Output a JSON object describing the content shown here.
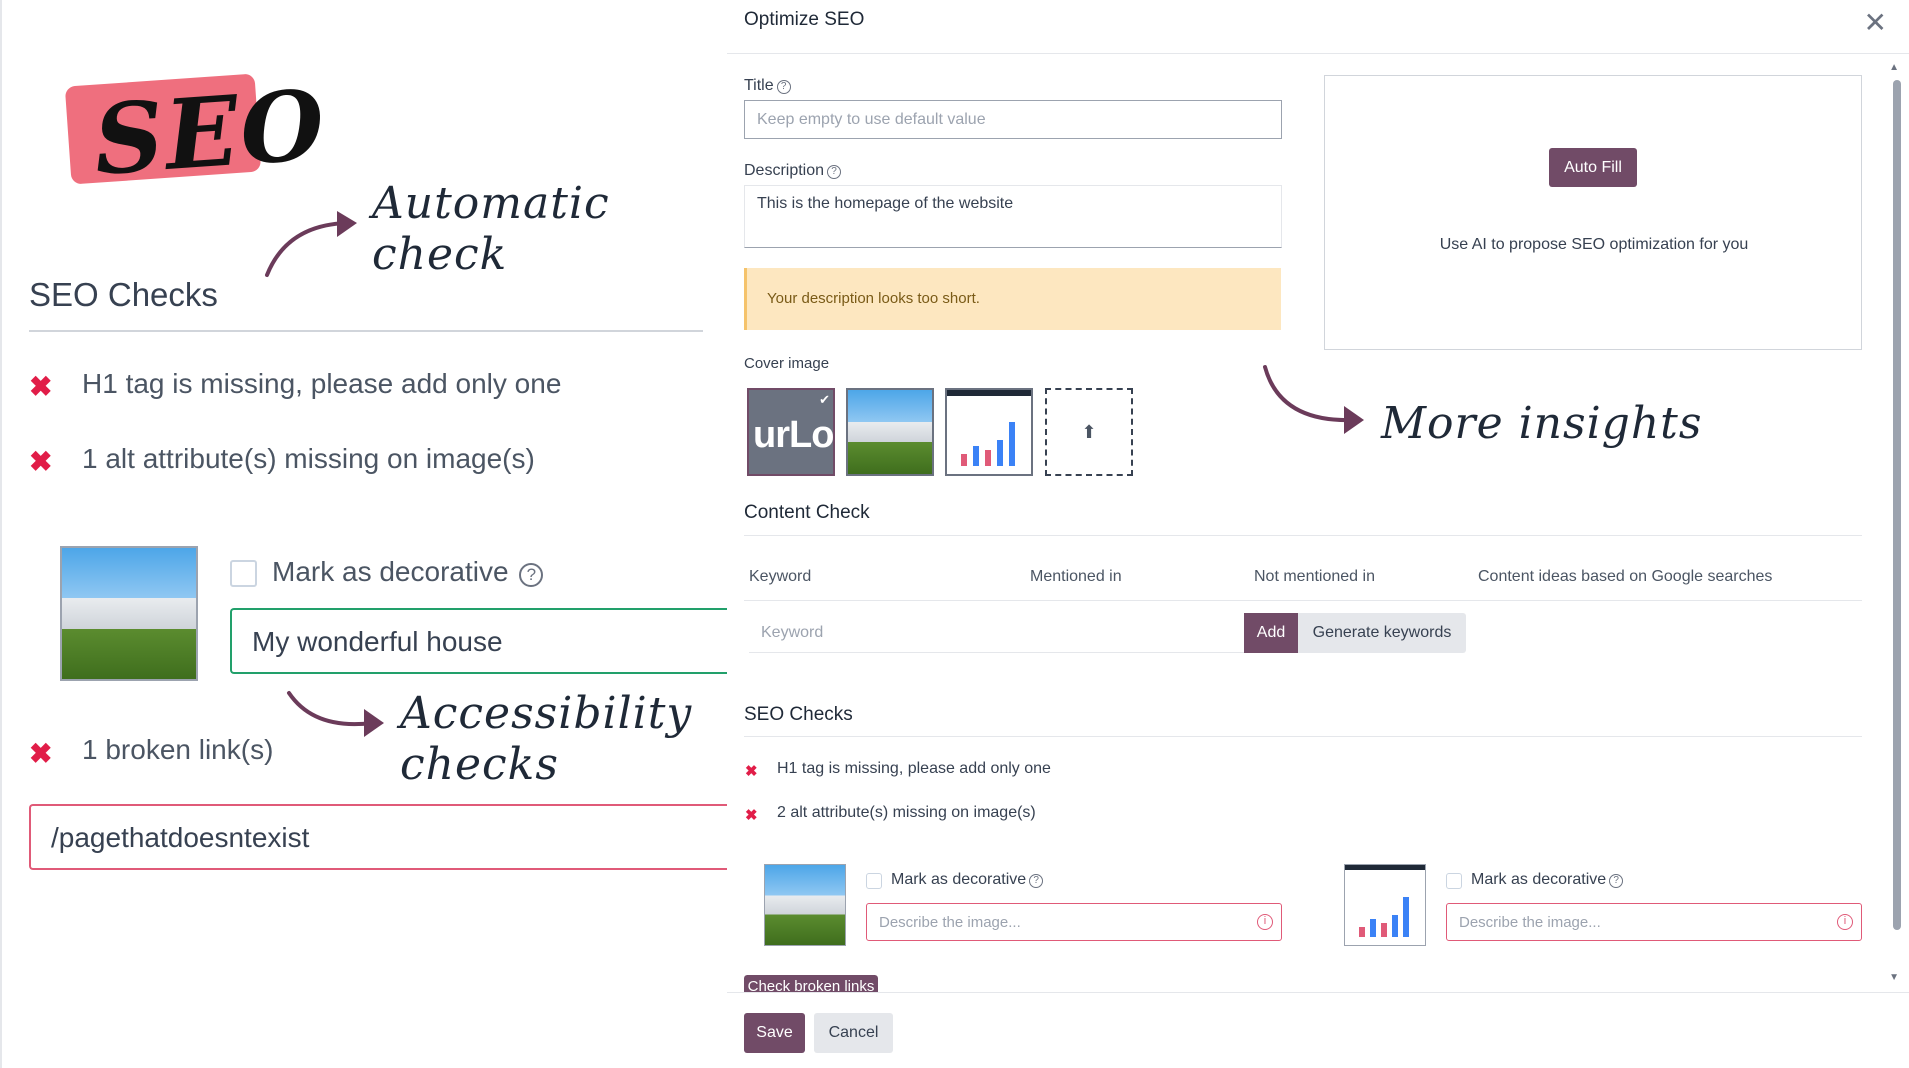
{
  "left_panel": {
    "logo_text": "SEO",
    "callout_automatic": "Automatic check",
    "callout_more": "More insights",
    "callout_accessibility": "Accessibility checks",
    "title": "SEO Checks",
    "checks": [
      "H1 tag is missing, please add only one",
      "1 alt attribute(s) missing on image(s)"
    ],
    "mark_decorative_label": "Mark as decorative",
    "alt_value": "My wonderful house",
    "broken_links_label": "1 broken link(s)",
    "broken_link_value": "/pagethatdoesntexist"
  },
  "modal": {
    "title": "Optimize SEO",
    "title_field": {
      "label": "Title",
      "placeholder": "Keep empty to use default value"
    },
    "description_field": {
      "label": "Description",
      "value": "This is the homepage of the website"
    },
    "warning": "Your description looks too short.",
    "ai_panel": {
      "button": "Auto Fill",
      "text": "Use AI to propose SEO optimization for you"
    },
    "cover_image_label": "Cover image",
    "cover_logo_text": "urLo",
    "content_check": {
      "title": "Content Check",
      "columns": [
        "Keyword",
        "Mentioned in",
        "Not mentioned in",
        "Content ideas based on Google searches"
      ],
      "keyword_placeholder": "Keyword",
      "add_button": "Add",
      "generate_button": "Generate keywords"
    },
    "seo_checks": {
      "title": "SEO Checks",
      "items": [
        "H1 tag is missing, please add only one",
        "2 alt attribute(s) missing on image(s)"
      ],
      "mark_decorative_label": "Mark as decorative",
      "describe_placeholder": "Describe the image...",
      "check_links_button": "Check broken links"
    },
    "footer": {
      "save": "Save",
      "cancel": "Cancel"
    }
  },
  "colors": {
    "primary": "#714b67",
    "error": "#e05a78",
    "warning_bg": "#fde7c0",
    "logo": "#ef6f7e"
  }
}
